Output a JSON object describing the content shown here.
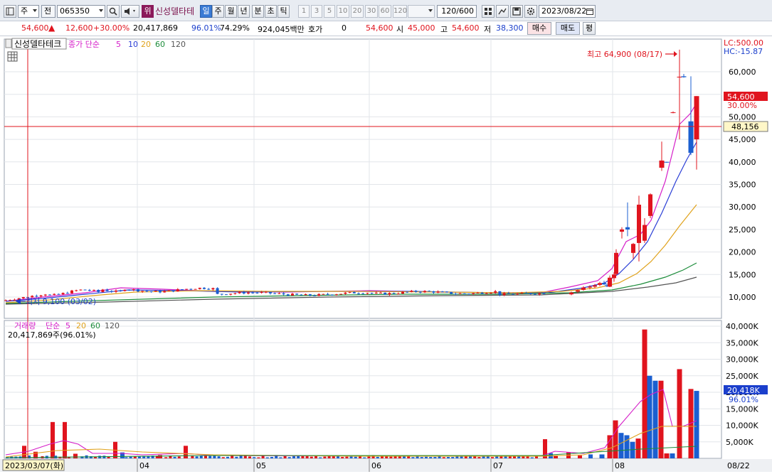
{
  "toolbar": {
    "type_label": "주",
    "prev_label": "전",
    "code": "065350",
    "badge": "위",
    "stock_name": "신성델타테",
    "periods": [
      "일",
      "주",
      "월",
      "년",
      "분",
      "초",
      "틱"
    ],
    "intervals": [
      "1",
      "3",
      "5",
      "10",
      "20",
      "30",
      "60",
      "120"
    ],
    "count": "120",
    "total": "/600",
    "date": "2023/08/22"
  },
  "quote": {
    "price": "54,600",
    "change": "12,600",
    "change_pct": "+30.00%",
    "volume": "20,417,869",
    "ratio1": "96.01%",
    "ratio2": "74.29%",
    "amount": "924,045백만",
    "hoga_label": "호가",
    "hoga_value": "0",
    "hoga_price": "54,600",
    "open_label": "시",
    "open": "45,000",
    "high_label": "고",
    "high": "54,600",
    "low_label": "저",
    "low": "38,300",
    "buy_label": "매수",
    "sell_label": "매도",
    "avg_label": "평"
  },
  "price_panel": {
    "stock_label": "신성델타테크",
    "ma_label": "종가 단순",
    "ma_periods": [
      "5",
      "10",
      "20",
      "60",
      "120"
    ],
    "ma_colors": [
      "#d51dc8",
      "#2a3ed6",
      "#e0a21b",
      "#1c8c3a",
      "#555555"
    ],
    "lc_label": "LC:500.00",
    "hc_label": "HC:-15.87",
    "high_annot": "최고 64,900 (08/17)",
    "low_annot": "최저 9,100 (03/02)",
    "last_price_tag": "54,600",
    "last_pct_tag": "30.00%",
    "cross_price_tag": "48,156"
  },
  "volume_panel": {
    "label": "거래량",
    "ma_label": "단순",
    "ma_periods": [
      "5",
      "20",
      "60",
      "120"
    ],
    "summary": "20,417,869주(96.01%)",
    "last_tag": "20,418K",
    "last_pct": "96.01%"
  },
  "x_axis": {
    "start_date": "2023/03/07(화)",
    "months": [
      "04",
      "05",
      "06",
      "07",
      "08"
    ],
    "end_label": "08/22"
  },
  "chart_data": {
    "type": "candlestick",
    "ylim_price": [
      7000,
      68000
    ],
    "price_ticks": [
      "10,000",
      "15,000",
      "20,000",
      "25,000",
      "30,000",
      "35,000",
      "40,000",
      "45,000",
      "50,000",
      "55,000",
      "60,000"
    ],
    "price_tick_values": [
      10000,
      15000,
      20000,
      25000,
      30000,
      35000,
      40000,
      45000,
      50000,
      55000,
      60000
    ],
    "volume_ticks": [
      "5,000K",
      "10,000K",
      "15,000K",
      "20,000K",
      "25,000K",
      "30,000K",
      "35,000K",
      "40,000K"
    ],
    "volume_tick_values": [
      5000,
      10000,
      15000,
      20000,
      25000,
      30000,
      35000,
      40000
    ],
    "ylim_volume": [
      0,
      41000
    ],
    "recent_candles": [
      {
        "o": 10600,
        "h": 11200,
        "l": 10400,
        "c": 11000
      },
      {
        "o": 11200,
        "h": 11700,
        "l": 10900,
        "c": 11500
      },
      {
        "o": 11600,
        "h": 12400,
        "l": 11400,
        "c": 12100
      },
      {
        "o": 12100,
        "h": 12600,
        "l": 11700,
        "c": 12300
      },
      {
        "o": 12300,
        "h": 12900,
        "l": 12000,
        "c": 12600
      },
      {
        "o": 12700,
        "h": 13400,
        "l": 12400,
        "c": 13100
      },
      {
        "o": 13100,
        "h": 13600,
        "l": 12700,
        "c": 12800
      },
      {
        "o": 12600,
        "h": 13000,
        "l": 12200,
        "c": 12400
      },
      {
        "o": 12300,
        "h": 14800,
        "l": 12200,
        "c": 14300
      },
      {
        "o": 14200,
        "h": 15500,
        "l": 13400,
        "c": 15000
      },
      {
        "o": 15100,
        "h": 20600,
        "l": 14800,
        "c": 19800
      },
      {
        "o": 24500,
        "h": 25500,
        "l": 23000,
        "c": 25000
      },
      {
        "o": 25500,
        "h": 31000,
        "l": 23500,
        "c": 25000
      },
      {
        "o": 19800,
        "h": 22000,
        "l": 18500,
        "c": 21800
      },
      {
        "o": 22000,
        "h": 32500,
        "l": 17900,
        "c": 30500
      },
      {
        "o": 22500,
        "h": 27500,
        "l": 22000,
        "c": 26000
      },
      {
        "o": 28000,
        "h": 33000,
        "l": 27500,
        "c": 32800
      },
      {
        "o": 38700,
        "h": 44500,
        "l": 38000,
        "c": 40300
      },
      {
        "o": 40000,
        "h": 40000,
        "l": 39800,
        "c": 39900
      },
      {
        "o": 51000,
        "h": 51200,
        "l": 50800,
        "c": 51000
      },
      {
        "o": 58900,
        "h": 64900,
        "l": 45000,
        "c": 58900
      },
      {
        "o": 59000,
        "h": 59500,
        "l": 58700,
        "c": 58800
      },
      {
        "o": 49000,
        "h": 59000,
        "l": 41500,
        "c": 42000
      },
      {
        "o": 45000,
        "h": 54600,
        "l": 38300,
        "c": 54600
      }
    ],
    "recent_volume": [
      1200,
      700,
      1500,
      1100,
      900,
      1300,
      800,
      600,
      3000,
      7200,
      12000,
      8000,
      7000,
      5000,
      6000,
      3000,
      39000,
      25000,
      23500,
      2000,
      1200,
      3000,
      27000,
      21000,
      20418
    ]
  }
}
